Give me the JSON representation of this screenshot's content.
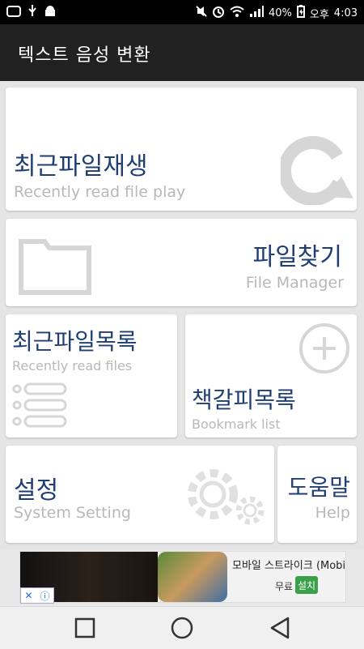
{
  "statusbar": {
    "battery": "40%",
    "time_prefix": "오후",
    "time": "4:03"
  },
  "appbar": {
    "title": "텍스트 음성 변환"
  },
  "tiles": {
    "recent_play": {
      "kr": "최근파일재생",
      "en": "Recently read file play"
    },
    "file_manager": {
      "kr": "파일찾기",
      "en": "File Manager"
    },
    "recent_files": {
      "kr": "최근파일목록",
      "en": "Recently read files"
    },
    "bookmarks": {
      "kr": "책갈피목록",
      "en": "Bookmark list"
    },
    "settings": {
      "kr": "설정",
      "en": "System Setting"
    },
    "help": {
      "kr": "도움말",
      "en": "Help"
    }
  },
  "ad": {
    "title": "모바일 스트라이크 (Mobi...",
    "free": "무료",
    "install": "설치"
  },
  "colors": {
    "accent": "#1f3f73",
    "sub": "#b8b8b8",
    "appbar": "#212121"
  }
}
